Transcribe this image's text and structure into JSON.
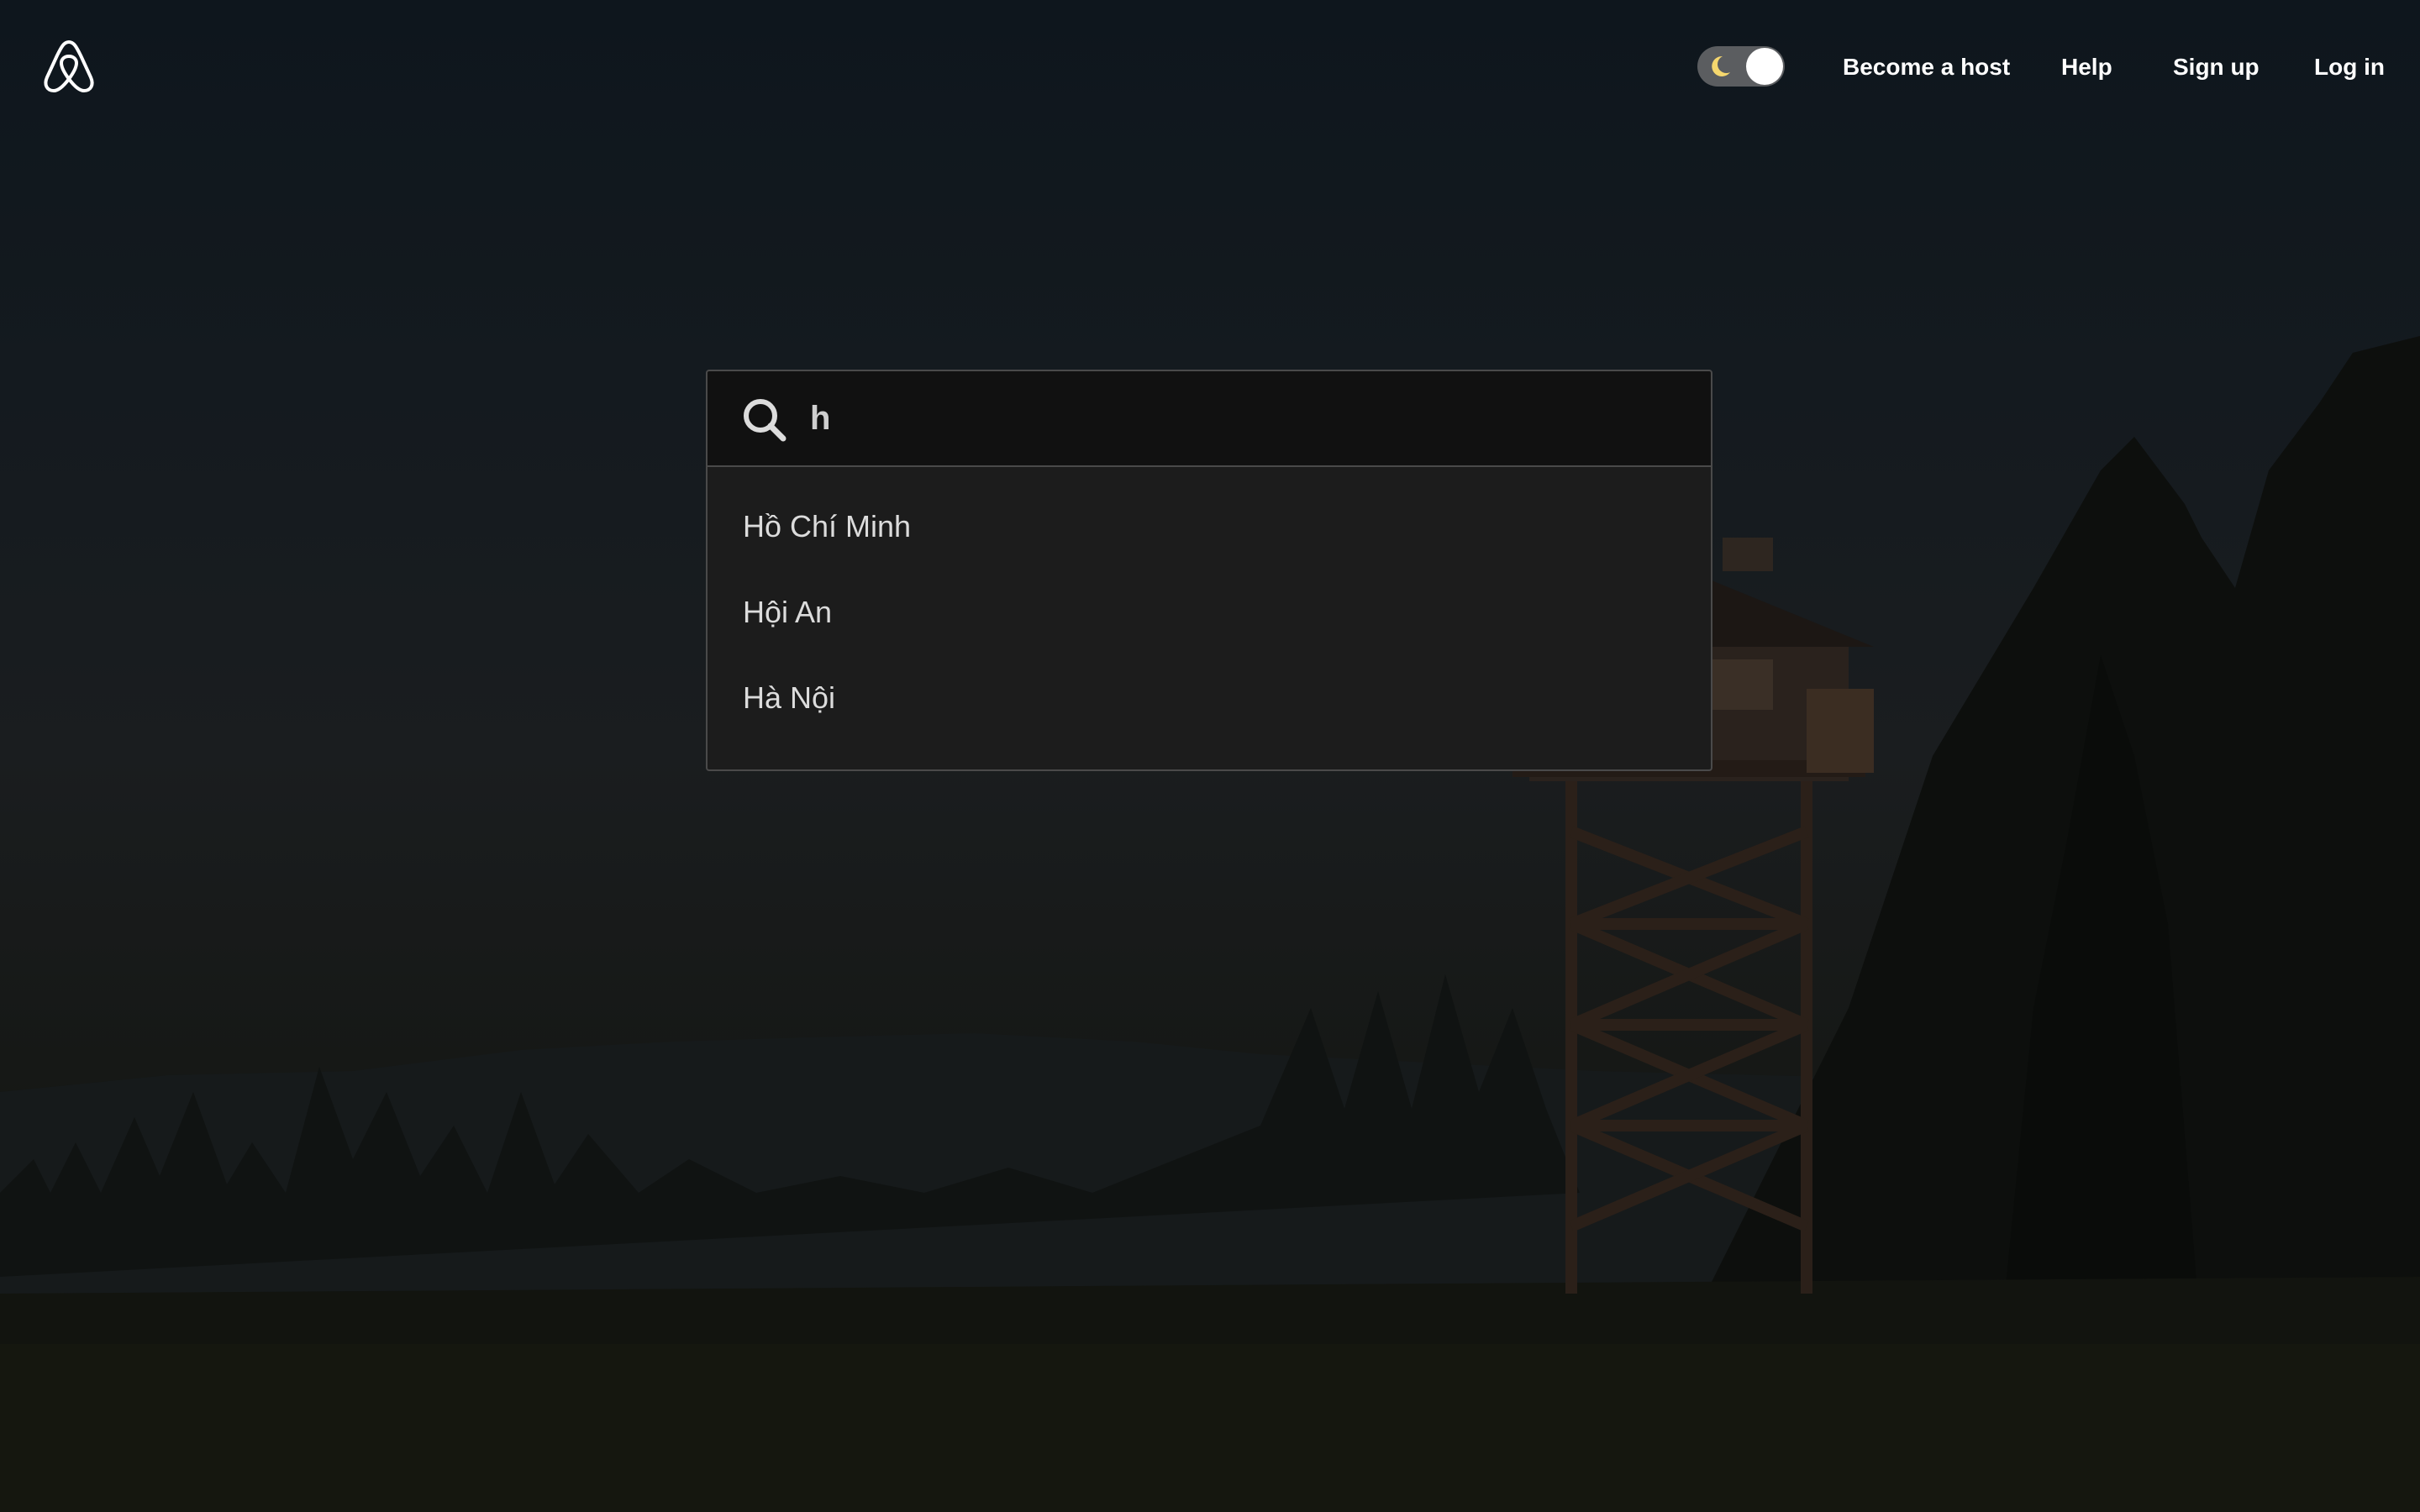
{
  "header": {
    "logo_icon": "airbnb-logo-icon",
    "theme_toggle": {
      "icon": "moon-icon",
      "state": "dark"
    },
    "nav": {
      "become_host": "Become a host",
      "help": "Help",
      "sign_up": "Sign up",
      "log_in": "Log in"
    }
  },
  "search": {
    "icon": "search-icon",
    "value": "h",
    "suggestions": [
      "Hồ Chí Minh",
      "Hội An",
      "Hà Nội"
    ]
  },
  "colors": {
    "moon": "#f5d76e",
    "input_bg": "#111111",
    "dropdown_bg": "#1c1c1c"
  }
}
